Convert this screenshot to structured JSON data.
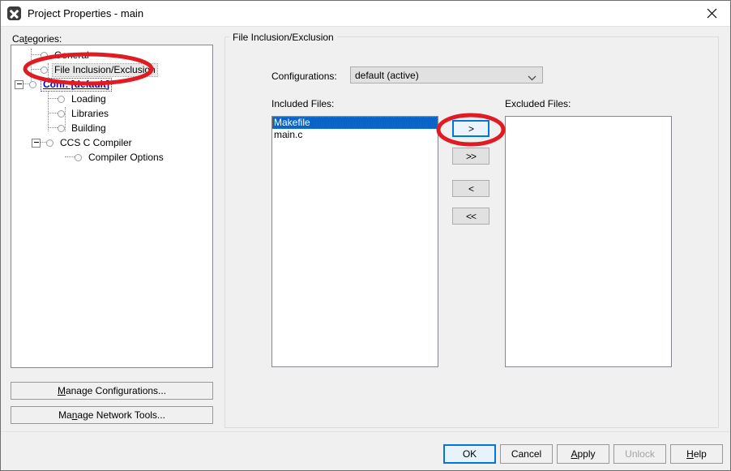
{
  "window": {
    "title": "Project Properties - main",
    "app_icon": "app-x-icon",
    "close_icon": "close-icon"
  },
  "left_panel": {
    "categories_label": "Categories:",
    "tree": [
      {
        "label": "General",
        "indent": 0,
        "style": "normal",
        "expander": null
      },
      {
        "label": "File Inclusion/Exclusion",
        "indent": 0,
        "style": "selected",
        "expander": null
      },
      {
        "label": "Conf: [default]",
        "indent": 0,
        "style": "link",
        "expander": "minus"
      },
      {
        "label": "Loading",
        "indent": 1,
        "style": "normal",
        "expander": null
      },
      {
        "label": "Libraries",
        "indent": 1,
        "style": "normal",
        "expander": null
      },
      {
        "label": "Building",
        "indent": 1,
        "style": "normal",
        "expander": null
      },
      {
        "label": "CCS C Compiler",
        "indent": 1,
        "style": "normal",
        "expander": "minus"
      },
      {
        "label": "Compiler Options",
        "indent": 2,
        "style": "normal",
        "expander": null
      }
    ],
    "manage_configurations": "Manage Configurations...",
    "manage_network_tools": "Manage Network Tools..."
  },
  "main": {
    "groupbox_title": "File Inclusion/Exclusion",
    "configurations_label": "Configurations:",
    "configurations_value": "default (active)",
    "configurations_chevron": "chevron-down-icon",
    "included_label": "Included Files:",
    "excluded_label": "Excluded Files:",
    "included_files": [
      {
        "name": "Makefile",
        "selected": true
      },
      {
        "name": "main.c",
        "selected": false
      }
    ],
    "excluded_files": [],
    "transfer_buttons": [
      {
        "label": ">",
        "name": "move-right-button",
        "focused": true
      },
      {
        "label": ">>",
        "name": "move-all-right-button",
        "focused": false
      },
      {
        "label": "<",
        "name": "move-left-button",
        "focused": false
      },
      {
        "label": "<<",
        "name": "move-all-left-button",
        "focused": false
      }
    ]
  },
  "footer": {
    "ok": "OK",
    "cancel": "Cancel",
    "apply": "Apply",
    "unlock": "Unlock",
    "help": "Help"
  },
  "annotations": {
    "color": "#e01b22",
    "ellipses": [
      {
        "name": "annotation-ellipse-tree-item",
        "target": "File Inclusion/Exclusion"
      },
      {
        "name": "annotation-ellipse-move-right",
        "target": ">"
      }
    ]
  },
  "colors": {
    "dialog_bg": "#f0f0f0",
    "titlebar_bg": "#ffffff",
    "selection_blue": "#0a64c8",
    "focus_blue": "#0078d7",
    "link_blue": "#0000c8",
    "annotation_red": "#e01b22",
    "disabled_text": "#a3a3a3"
  }
}
